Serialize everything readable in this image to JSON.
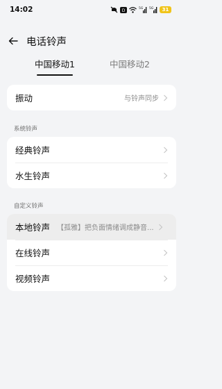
{
  "status_bar": {
    "time": "14:02",
    "signal_1": "5G",
    "signal_2": "5G",
    "battery": "31"
  },
  "header": {
    "back_icon": "arrow-left-icon",
    "title": "电话铃声"
  },
  "tabs": [
    {
      "label": "中国移动1",
      "active": true
    },
    {
      "label": "中国移动2",
      "active": false
    }
  ],
  "vibration": {
    "label": "振动",
    "value": "与铃声同步"
  },
  "system_ringtones": {
    "section_label": "系统铃声",
    "items": [
      {
        "label": "经典铃声"
      },
      {
        "label": "水生铃声"
      }
    ]
  },
  "custom_ringtones": {
    "section_label": "自定义铃声",
    "items": [
      {
        "label": "本地铃声",
        "value": "【孤雅】把负面情绪调成静音..."
      },
      {
        "label": "在线铃声"
      },
      {
        "label": "视频铃声"
      }
    ]
  },
  "colors": {
    "background": "#f3f4f6",
    "card": "#ffffff",
    "battery": "#f0c419",
    "text_primary": "#111111",
    "text_secondary": "#8c8c8c"
  }
}
